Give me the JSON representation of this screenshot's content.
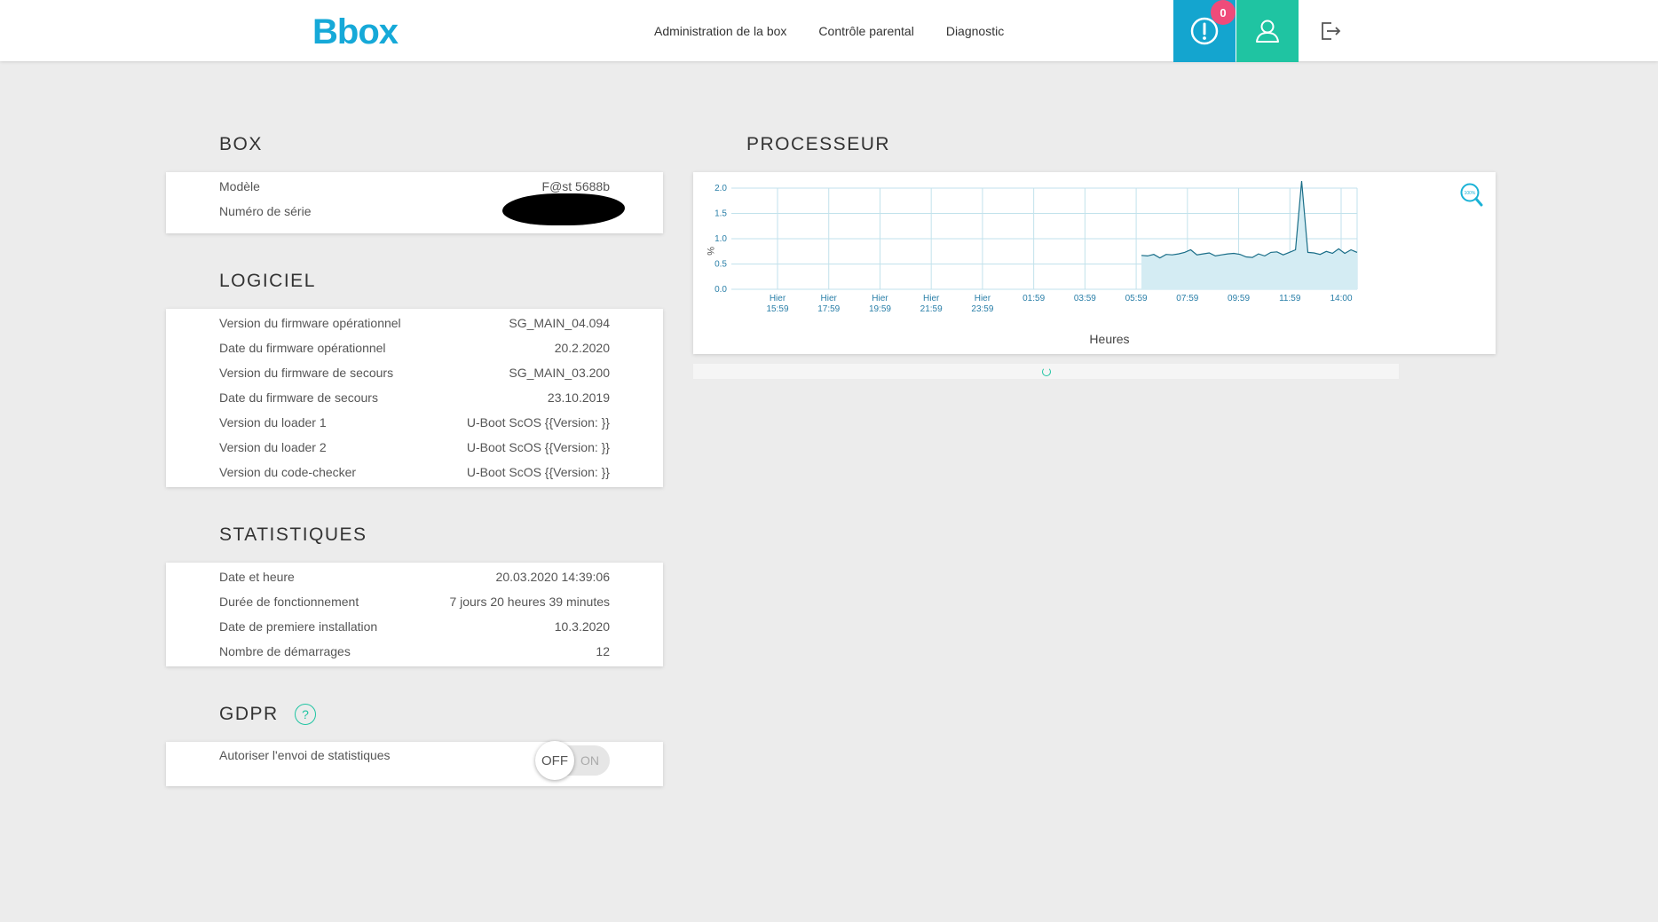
{
  "header": {
    "logo": "Bbox",
    "nav": [
      "Administration de la box",
      "Contrôle parental",
      "Diagnostic"
    ],
    "alert_count": "0"
  },
  "box": {
    "title": "BOX",
    "rows": [
      {
        "label": "Modèle",
        "value": "F@st 5688b"
      },
      {
        "label": "Numéro de série",
        "value": ""
      }
    ]
  },
  "logiciel": {
    "title": "LOGICIEL",
    "rows": [
      {
        "label": "Version du firmware opérationnel",
        "value": "SG_MAIN_04.094"
      },
      {
        "label": "Date du firmware opérationnel",
        "value": "20.2.2020"
      },
      {
        "label": "Version du firmware de secours",
        "value": "SG_MAIN_03.200"
      },
      {
        "label": "Date du firmware de secours",
        "value": "23.10.2019"
      },
      {
        "label": "Version du loader 1",
        "value": "U-Boot ScOS {{Version: }}"
      },
      {
        "label": "Version du loader 2",
        "value": "U-Boot ScOS {{Version: }}"
      },
      {
        "label": "Version du code-checker",
        "value": "U-Boot ScOS {{Version: }}"
      }
    ]
  },
  "statistiques": {
    "title": "STATISTIQUES",
    "rows": [
      {
        "label": "Date et heure",
        "value": "20.03.2020 14:39:06"
      },
      {
        "label": "Durée de fonctionnement",
        "value": "7 jours 20 heures 39 minutes"
      },
      {
        "label": "Date de premiere installation",
        "value": "10.3.2020"
      },
      {
        "label": "Nombre de démarrages",
        "value": "12"
      }
    ]
  },
  "gdpr": {
    "title": "GDPR",
    "help": "?",
    "row_label": "Autoriser l'envoi de statistiques",
    "toggle_off": "OFF",
    "toggle_on": "ON"
  },
  "processeur": {
    "title": "PROCESSEUR",
    "zoom_label": "100%"
  },
  "chart_data": {
    "type": "area",
    "ylabel": "%",
    "xlabel": "Heures",
    "ylim": [
      0,
      2.0
    ],
    "yticks": [
      "0.0",
      "0.5",
      "1.0",
      "1.5",
      "2.0"
    ],
    "xticks": [
      [
        "Hier",
        "15:59"
      ],
      [
        "Hier",
        "17:59"
      ],
      [
        "Hier",
        "19:59"
      ],
      [
        "Hier",
        "21:59"
      ],
      [
        "Hier",
        "23:59"
      ],
      [
        "01:59",
        ""
      ],
      [
        "03:59",
        ""
      ],
      [
        "05:59",
        ""
      ],
      [
        "07:59",
        ""
      ],
      [
        "09:59",
        ""
      ],
      [
        "11:59",
        ""
      ],
      [
        "14:00",
        ""
      ]
    ],
    "series": [
      {
        "values": [
          0.67,
          0.66,
          0.69,
          0.62,
          0.69,
          0.68,
          0.7,
          0.73,
          0.78,
          0.68,
          0.7,
          0.72,
          0.66,
          0.68,
          0.7,
          0.71,
          0.69,
          0.64,
          0.63,
          0.7,
          0.66,
          0.73,
          0.74,
          0.68,
          0.73,
          0.78,
          2.14,
          0.73,
          0.72,
          0.69,
          0.75,
          0.71,
          0.8,
          0.71,
          0.78,
          0.73
        ]
      }
    ],
    "colors": {
      "line": "#1a6e88",
      "fill": "#d4ecf3",
      "grid": "#c2e2ec",
      "tick": "#2a7fa8"
    }
  }
}
